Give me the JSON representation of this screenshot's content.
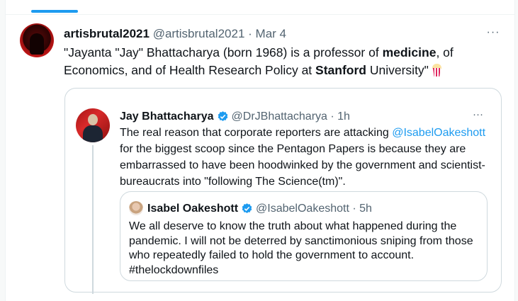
{
  "main_tweet": {
    "name": "artisbrutal2021",
    "handle": "@artisbrutal2021",
    "separator": "·",
    "date": "Mar 4",
    "more": "···",
    "text_parts": {
      "p1": "\"Jayanta \"Jay\" Bhattacharya (born 1968) is a professor of ",
      "b1": "medicine",
      "p2": ", of Economics, and of Health Research Policy at ",
      "b2": "Stanford",
      "p3": " University\""
    },
    "emoji_icon": "popcorn-icon"
  },
  "quoted_tweet": {
    "name": "Jay Bhattacharya",
    "handle": "@DrJBhattacharya",
    "separator": "·",
    "time": "1h",
    "more": "···",
    "text_parts": {
      "p1": "The real reason that corporate reporters are attacking ",
      "mention": "@IsabelOakeshott",
      "p2": " for the biggest scoop since the Pentagon Papers is because they are embarrassed to have been hoodwinked by the government and scientist-bureaucrats into \"following The Science(tm)\"."
    }
  },
  "nested_quote": {
    "name": "Isabel Oakeshott",
    "handle": "@IsabelOakeshott",
    "separator": "·",
    "time": "5h",
    "text": "We all deserve to know the truth about what happened during the pandemic. I will not be deterred by sanctimonious sniping from those who repeatedly failed to hold the government to account. #thelockdownfiles"
  },
  "colors": {
    "accent": "#1d9bf0",
    "text": "#0f1419",
    "muted": "#536471",
    "border": "#cfd9de"
  }
}
